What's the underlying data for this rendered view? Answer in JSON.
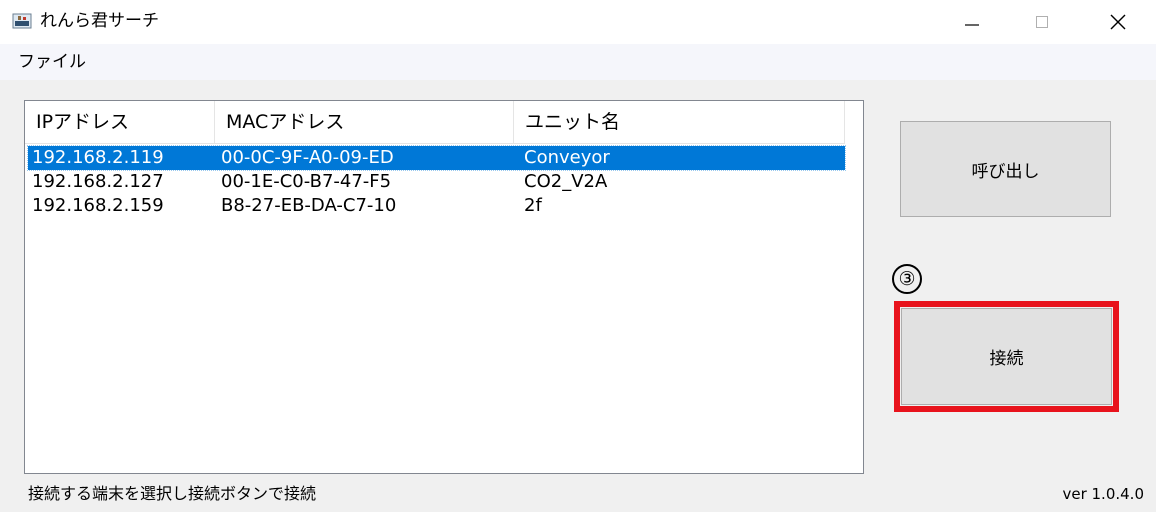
{
  "window": {
    "title": "れんら君サーチ",
    "icons": {
      "app": "app-icon",
      "minimize": "minimize-icon",
      "maximize": "maximize-icon",
      "close": "close-icon"
    }
  },
  "menu": {
    "items": [
      "ファイル"
    ]
  },
  "table": {
    "headers": [
      "IPアドレス",
      "MACアドレス",
      "ユニット名"
    ],
    "rows": [
      {
        "ip": "192.168.2.119",
        "mac": "00-0C-9F-A0-09-ED",
        "unit": "Conveyor",
        "selected": true
      },
      {
        "ip": "192.168.2.127",
        "mac": "00-1E-C0-B7-47-F5",
        "unit": "CO2_V2A",
        "selected": false
      },
      {
        "ip": "192.168.2.159",
        "mac": "B8-27-EB-DA-C7-10",
        "unit": "2f",
        "selected": false
      }
    ]
  },
  "buttons": {
    "call": "呼び出し",
    "connect": "接続"
  },
  "annotation": {
    "step": "③",
    "highlight_color": "#e8131c"
  },
  "status": {
    "text": "接続する端末を選択し接続ボタンで接続",
    "version": "ver 1.0.4.0"
  },
  "colors": {
    "selection": "#0078d7"
  }
}
